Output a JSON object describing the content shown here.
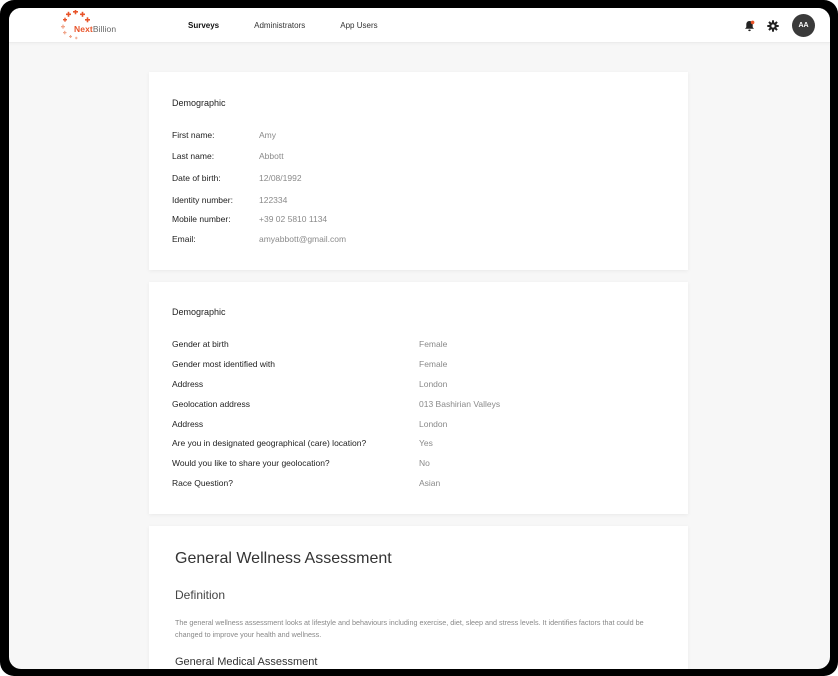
{
  "brand": {
    "name_part1": "Next",
    "name_part2": "Billion",
    "accent": "#e8542a"
  },
  "nav": {
    "items": [
      {
        "label": "Surveys",
        "active": true
      },
      {
        "label": "Administrators",
        "active": false
      },
      {
        "label": "App Users",
        "active": false
      }
    ]
  },
  "header": {
    "avatar_initials": "AA",
    "icons": [
      "bell-icon",
      "gear-icon"
    ]
  },
  "personal": {
    "title": "Demographic",
    "fields": [
      {
        "label": "First name:",
        "value": "Amy"
      },
      {
        "label": "Last name:",
        "value": "Abbott"
      },
      {
        "label": "Date of birth:",
        "value": "12/08/1992"
      },
      {
        "label": "Identity number:",
        "value": "122334"
      },
      {
        "label": "Mobile number:",
        "value": "+39 02 5810 1134"
      },
      {
        "label": "Email:",
        "value": "amyabbott@gmail.com"
      }
    ]
  },
  "demographic": {
    "title": "Demographic",
    "fields": [
      {
        "label": "Gender at birth",
        "value": "Female"
      },
      {
        "label": "Gender most identified with",
        "value": "Female"
      },
      {
        "label": "Address",
        "value": "London"
      },
      {
        "label": "Geolocation address",
        "value": "013 Bashirian Valleys"
      },
      {
        "label": "Address",
        "value": "London"
      },
      {
        "label": "Are you in designated geographical (care) location?",
        "value": "Yes"
      },
      {
        "label": "Would you like to share your geolocation?",
        "value": "No"
      },
      {
        "label": "Race Question?",
        "value": "Asian"
      }
    ]
  },
  "wellness": {
    "title": "General Wellness Assessment",
    "definition_heading": "Definition",
    "definition_text": "The general wellness assessment looks at lifestyle and behaviours including exercise, diet, sleep and stress levels. It identifies factors that could be changed to improve your health and wellness.",
    "next_heading": "General Medical Assessment"
  }
}
